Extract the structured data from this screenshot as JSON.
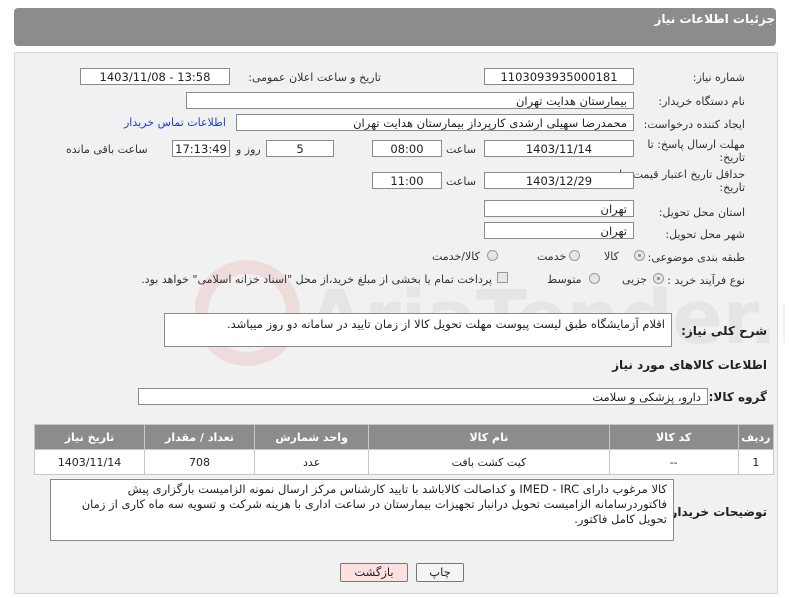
{
  "header": {
    "title": "جزئیات اطلاعات نیاز"
  },
  "form": {
    "need_number_label": "شماره نیاز:",
    "need_number": "1103093935000181",
    "announce_label": "تاریخ و ساعت اعلان عمومی:",
    "announce_value": "1403/11/08 - 13:58",
    "buyer_org_label": "نام دستگاه خریدار:",
    "buyer_org": "بیمارستان هدایت تهران",
    "creator_label": "ایجاد کننده درخواست:",
    "creator": "محمدرضا سهیلی ارشدی کارپرداز بیمارستان هدایت تهران",
    "contact_link": "اطلاعات تماس خریدار",
    "reply_deadline_label_1": "مهلت ارسال پاسخ: تا",
    "reply_deadline_label_2": "تاریخ:",
    "reply_date": "1403/11/14",
    "time_label": "ساعت",
    "reply_time": "08:00",
    "days_value": "5",
    "days_label": "روز و",
    "remaining_time": "17:13:49",
    "remaining_label": "ساعت باقی مانده",
    "validity_label_1": "حداقل تاریخ اعتبار قیمت: تا",
    "validity_label_2": "تاریخ:",
    "validity_date": "1403/12/29",
    "validity_time": "11:00",
    "province_label": "استان محل تحویل:",
    "province": "تهران",
    "city_label": "شهر محل تحویل:",
    "city": "تهران",
    "category_label": "طبقه بندی موضوعی:",
    "category_options": [
      "کالا",
      "خدمت",
      "کالا/خدمت"
    ],
    "process_label": "نوع فرآیند خرید :",
    "process_options": [
      "جزیی",
      "متوسط"
    ],
    "payment_note": "پرداخت تمام یا بخشی از مبلغ خرید،از محل \"اسناد خزانه اسلامی\" خواهد بود."
  },
  "description": {
    "label": "شرح کلی نیاز:",
    "text": "اقلام آزمایشگاه طبق لیست پیوست مهلت تحویل کالا از زمان تایید در سامانه دو روز میباشد."
  },
  "goods": {
    "section_title": "اطلاعات کالاهای مورد نیاز",
    "group_label": "گروه کالا:",
    "group_value": "دارو، پزشکی و سلامت",
    "columns": [
      "ردیف",
      "کد کالا",
      "نام کالا",
      "واحد شمارش",
      "تعداد / مقدار",
      "تاریخ نیاز"
    ],
    "rows": [
      [
        "1",
        "--",
        "کیت کشت بافت",
        "عدد",
        "708",
        "1403/11/14"
      ]
    ]
  },
  "buyer_notes": {
    "label": "توضیحات خریدار:",
    "text": "کالا مرغوب دارای IMED - IRC و کداصالت کالاباشد با تایید کارشناس مرکز ارسال نمونه الزامیست بارگزاری پیش فاکتوردرسامانه الزامیست تحویل درانبار تجهیزات بیمارستان در ساعت اداری با هزینه شرکت و تسویه سه ماه کاری از زمان تحویل کامل فاکتور."
  },
  "buttons": {
    "print": "چاپ",
    "back": "بازگشت"
  },
  "watermark": {
    "text": "AriaTender.net",
    "color": "#d9534f"
  }
}
